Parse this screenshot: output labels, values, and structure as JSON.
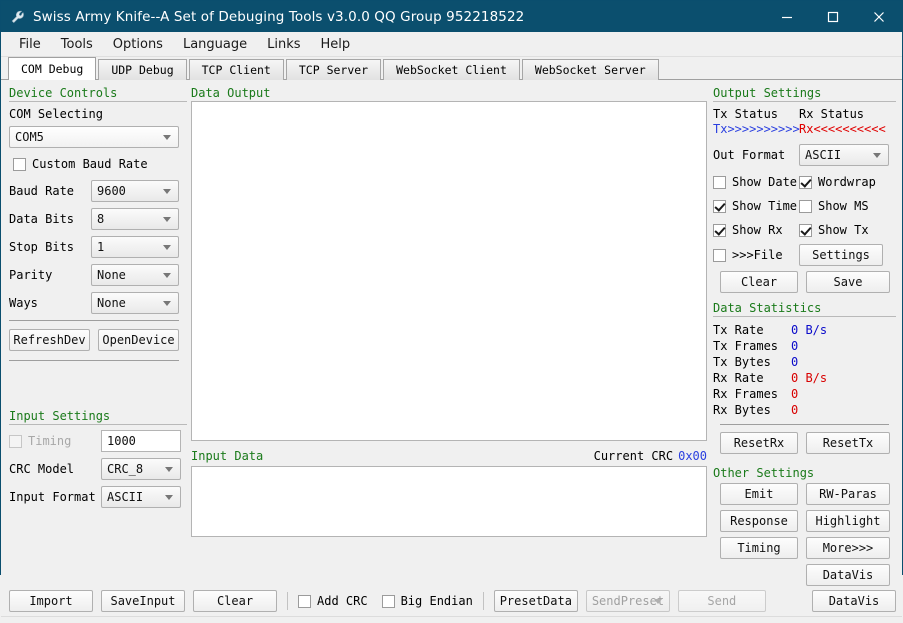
{
  "window": {
    "title": "Swiss Army Knife--A Set of Debuging Tools v3.0.0 QQ Group 952218522",
    "icon": "wrench-icon",
    "minimize": "minimize-icon",
    "maximize": "maximize-icon",
    "close": "close-icon",
    "titlebar_color": "#0b4f6e"
  },
  "menubar": {
    "items": [
      {
        "label": "File"
      },
      {
        "label": "Tools"
      },
      {
        "label": "Options"
      },
      {
        "label": "Language"
      },
      {
        "label": "Links"
      },
      {
        "label": "Help"
      }
    ]
  },
  "tabs": {
    "active": "COM Debug",
    "items": [
      {
        "label": "COM Debug"
      },
      {
        "label": "UDP Debug"
      },
      {
        "label": "TCP Client"
      },
      {
        "label": "TCP Server"
      },
      {
        "label": "WebSocket Client"
      },
      {
        "label": "WebSocket Server"
      }
    ]
  },
  "device_controls": {
    "title": "Device Controls",
    "com_selecting_label": "COM Selecting",
    "com_value": "COM5",
    "custom_baud_label": "Custom Baud Rate",
    "custom_baud_checked": false,
    "fields": [
      {
        "label": "Baud Rate",
        "value": "9600"
      },
      {
        "label": "Data Bits",
        "value": "8"
      },
      {
        "label": "Stop Bits",
        "value": "1"
      },
      {
        "label": "Parity",
        "value": "None"
      },
      {
        "label": "Ways",
        "value": "None"
      }
    ],
    "refresh_label": "RefreshDev",
    "open_label": "OpenDevice"
  },
  "input_settings": {
    "title": "Input Settings",
    "timing_label": "Timing",
    "timing_checked": false,
    "timing_value": "1000",
    "crc_model_label": "CRC Model",
    "crc_model_value": "CRC_8",
    "input_format_label": "Input Format",
    "input_format_value": "ASCII",
    "import_label": "Import",
    "saveinput_label": "SaveInput"
  },
  "data_output": {
    "title": "Data Output",
    "content": ""
  },
  "input_data": {
    "title": "Input Data",
    "crc_label": "Current CRC",
    "crc_value": "0x00",
    "content": ""
  },
  "bottom_bar": {
    "clear_label": "Clear",
    "add_crc_label": "Add CRC",
    "add_crc_checked": false,
    "big_endian_label": "Big Endian",
    "big_endian_checked": false,
    "preset_data_label": "PresetData",
    "send_preset_label": "SendPreset",
    "send_preset_disabled": true,
    "send_label": "Send",
    "send_disabled": true
  },
  "output_settings": {
    "title": "Output Settings",
    "tx_status_label": "Tx Status",
    "rx_status_label": "Rx Status",
    "tx_arrows": "Tx>>>>>>>>>>",
    "rx_arrows": "Rx<<<<<<<<<<",
    "out_format_label": "Out Format",
    "out_format_value": "ASCII",
    "show_date_label": "Show Date",
    "show_date_checked": false,
    "wordwrap_label": "Wordwrap",
    "wordwrap_checked": true,
    "show_time_label": "Show Time",
    "show_time_checked": true,
    "show_ms_label": "Show MS",
    "show_ms_checked": false,
    "show_rx_label": "Show Rx",
    "show_rx_checked": true,
    "show_tx_label": "Show Tx",
    "show_tx_checked": true,
    "to_file_label": ">>>File",
    "to_file_checked": false,
    "settings_label": "Settings",
    "clear_label": "Clear",
    "save_label": "Save"
  },
  "data_statistics": {
    "title": "Data Statistics",
    "rows": [
      {
        "name": "Tx Rate",
        "value": "0 B/s",
        "kind": "tx"
      },
      {
        "name": "Tx Frames",
        "value": "0",
        "kind": "tx"
      },
      {
        "name": "Tx Bytes",
        "value": "0",
        "kind": "tx"
      },
      {
        "name": "Rx Rate",
        "value": "0 B/s",
        "kind": "rx"
      },
      {
        "name": "Rx Frames",
        "value": "0",
        "kind": "rx"
      },
      {
        "name": "Rx Bytes",
        "value": "0",
        "kind": "rx"
      }
    ],
    "reset_rx_label": "ResetRx",
    "reset_tx_label": "ResetTx"
  },
  "other_settings": {
    "title": "Other Settings",
    "emit_label": "Emit",
    "rw_paras_label": "RW-Paras",
    "response_label": "Response",
    "highlight_label": "Highlight",
    "timing_label": "Timing",
    "more_label": "More>>>",
    "datavis_label": "DataVis"
  },
  "colors": {
    "group_title": "#1a7a1a",
    "tx": "#2a3fe0",
    "rx": "#e00000",
    "titlebar": "#0b4f6e"
  }
}
